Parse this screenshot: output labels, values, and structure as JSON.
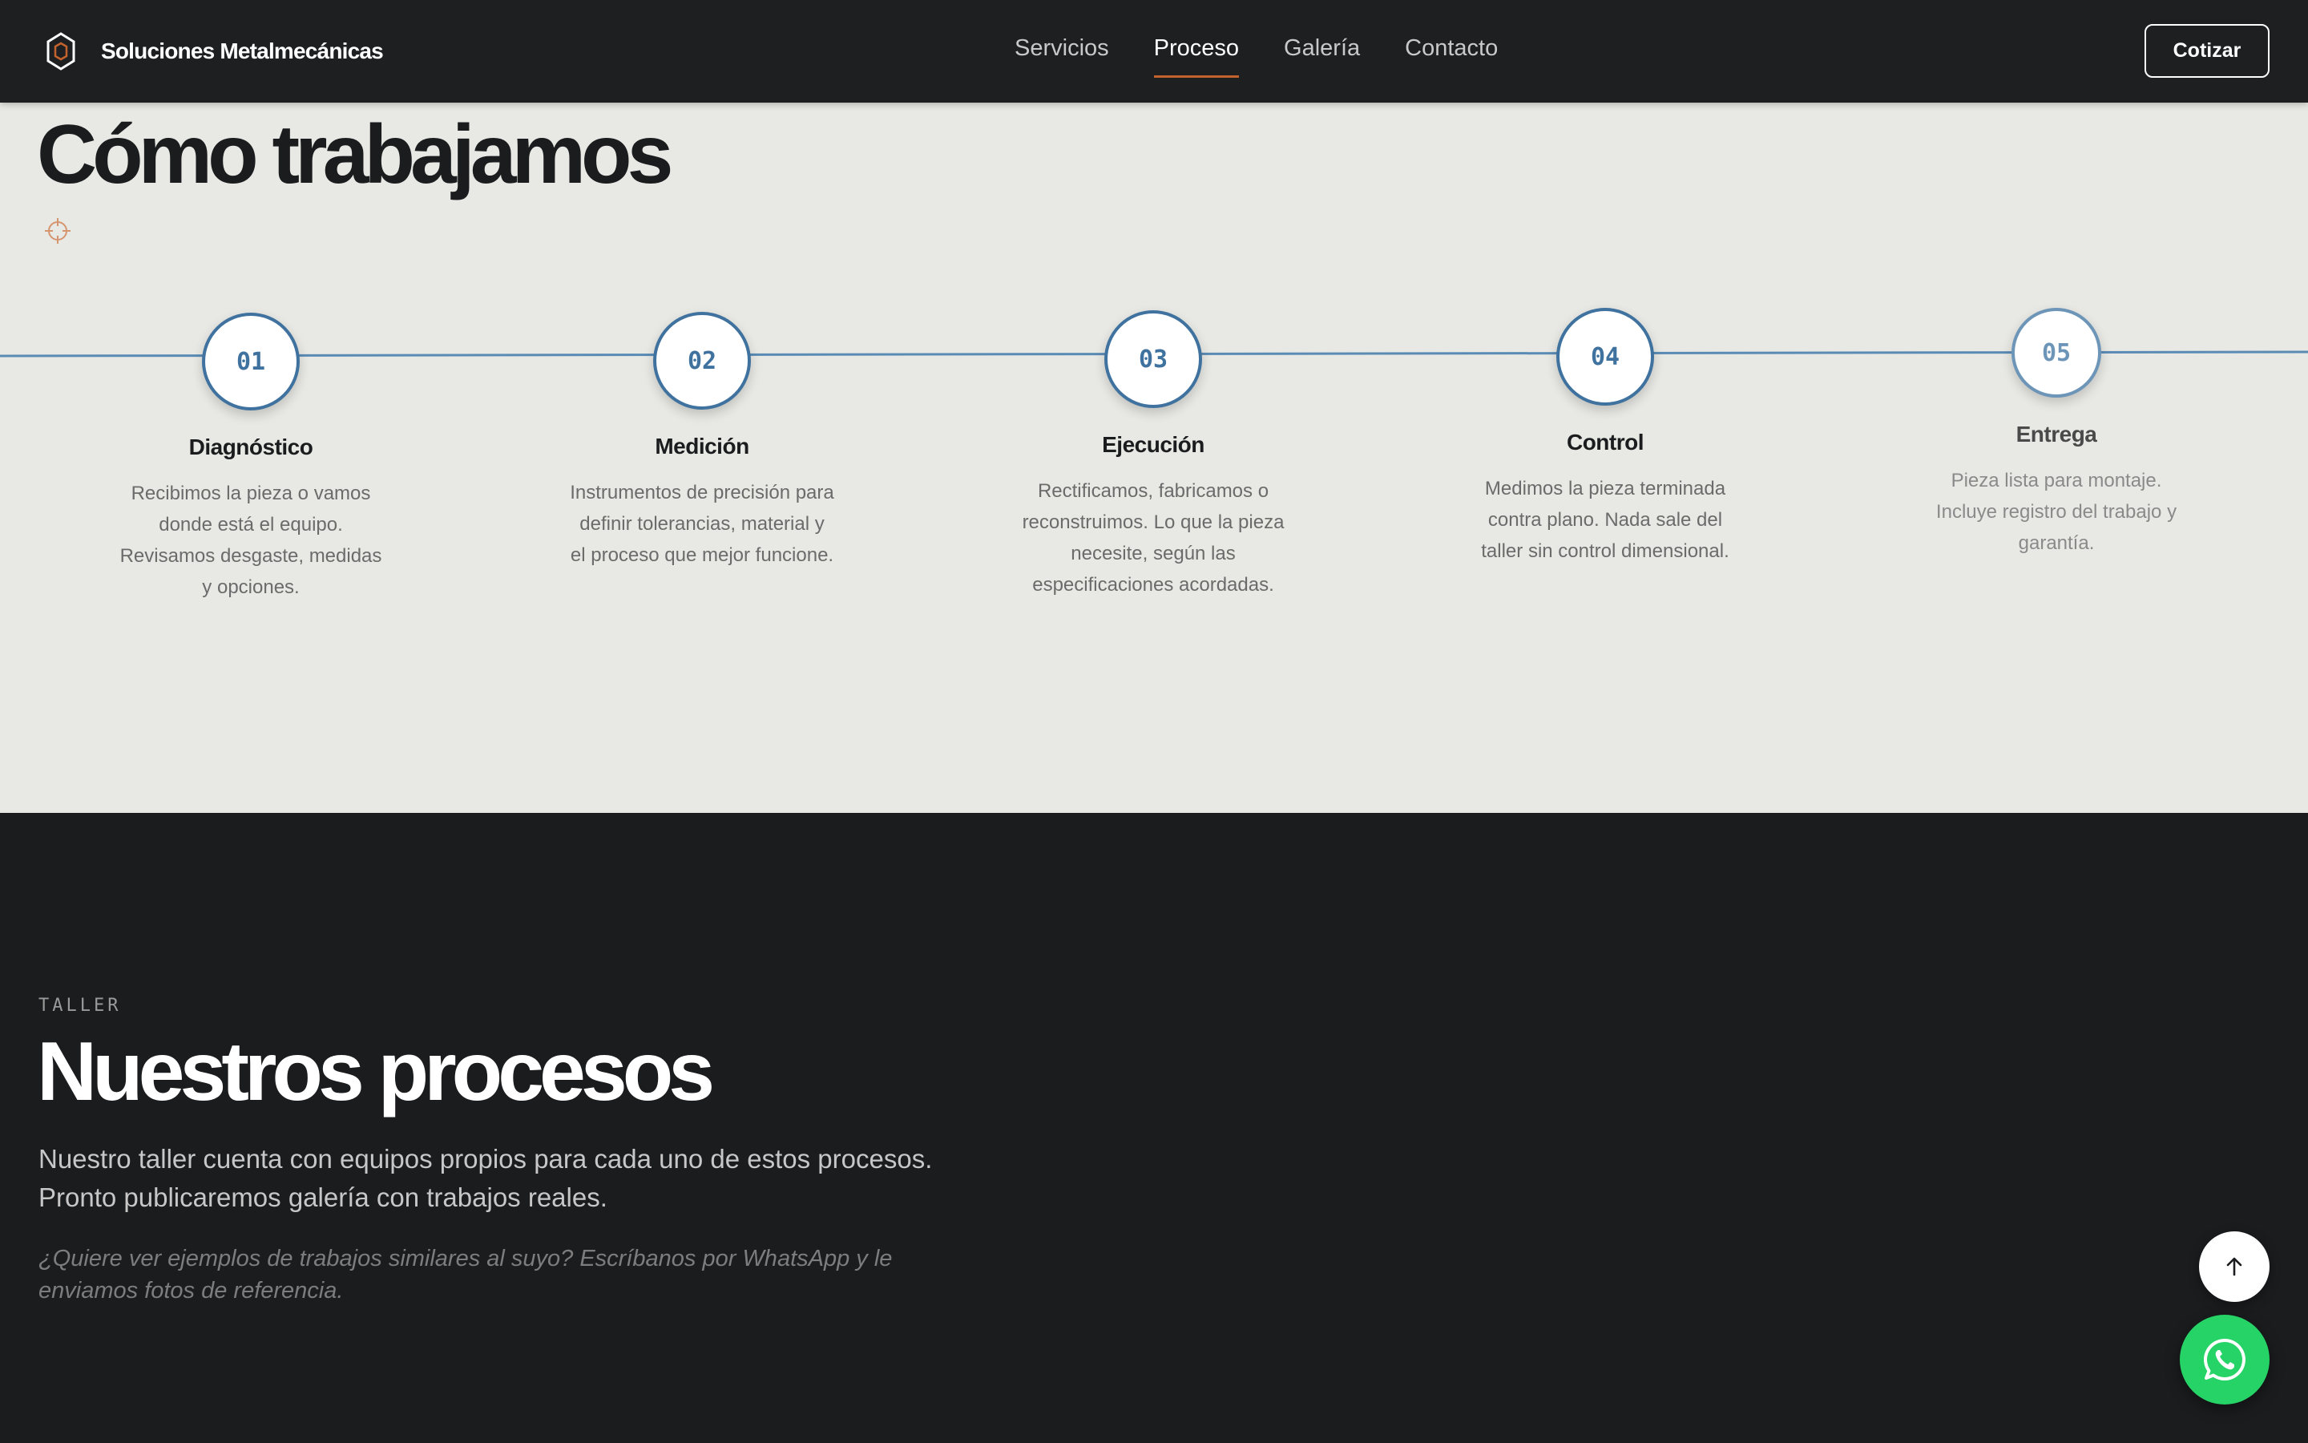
{
  "header": {
    "brand_name": "Soluciones Metalmecánicas",
    "logo_icon": "hexagon-logo-icon",
    "nav": [
      {
        "label": "Servicios",
        "active": false
      },
      {
        "label": "Proceso",
        "active": true
      },
      {
        "label": "Galería",
        "active": false
      },
      {
        "label": "Contacto",
        "active": false
      }
    ],
    "cta_label": "Cotizar"
  },
  "process": {
    "title": "Cómo trabajamos",
    "icon": "target-crosshair-icon",
    "steps": [
      {
        "number": "01",
        "title": "Diagnóstico",
        "description": "Recibimos la pieza o vamos donde está el equipo. Revisamos desgaste, medidas y opciones."
      },
      {
        "number": "02",
        "title": "Medición",
        "description": "Instrumentos de precisión para definir tolerancias, material y el proceso que mejor funcione."
      },
      {
        "number": "03",
        "title": "Ejecución",
        "description": "Rectificamos, fabricamos o reconstruimos. Lo que la pieza necesite, según las especificaciones acordadas."
      },
      {
        "number": "04",
        "title": "Control",
        "description": "Medimos la pieza terminada contra plano. Nada sale del taller sin control dimensional."
      },
      {
        "number": "05",
        "title": "Entrega",
        "description": "Pieza lista para montaje. Incluye registro del trabajo y garantía."
      }
    ]
  },
  "taller": {
    "eyebrow": "TALLER",
    "title": "Nuestros procesos",
    "body": "Nuestro taller cuenta con equipos propios para cada uno de estos procesos. Pronto publicaremos galería con trabajos reales.",
    "note": "¿Quiere ver ejemplos de trabajos similares al suyo? Escríbanos por WhatsApp y le enviamos fotos de referencia."
  },
  "floating": {
    "scroll_top_icon": "arrow-up-icon",
    "whatsapp_icon": "whatsapp-icon"
  },
  "colors": {
    "accent": "#c4622d",
    "step_blue": "#3f729e",
    "whatsapp": "#25d366",
    "dark_bg": "#1b1c1e",
    "light_bg": "#e8e8e4"
  }
}
